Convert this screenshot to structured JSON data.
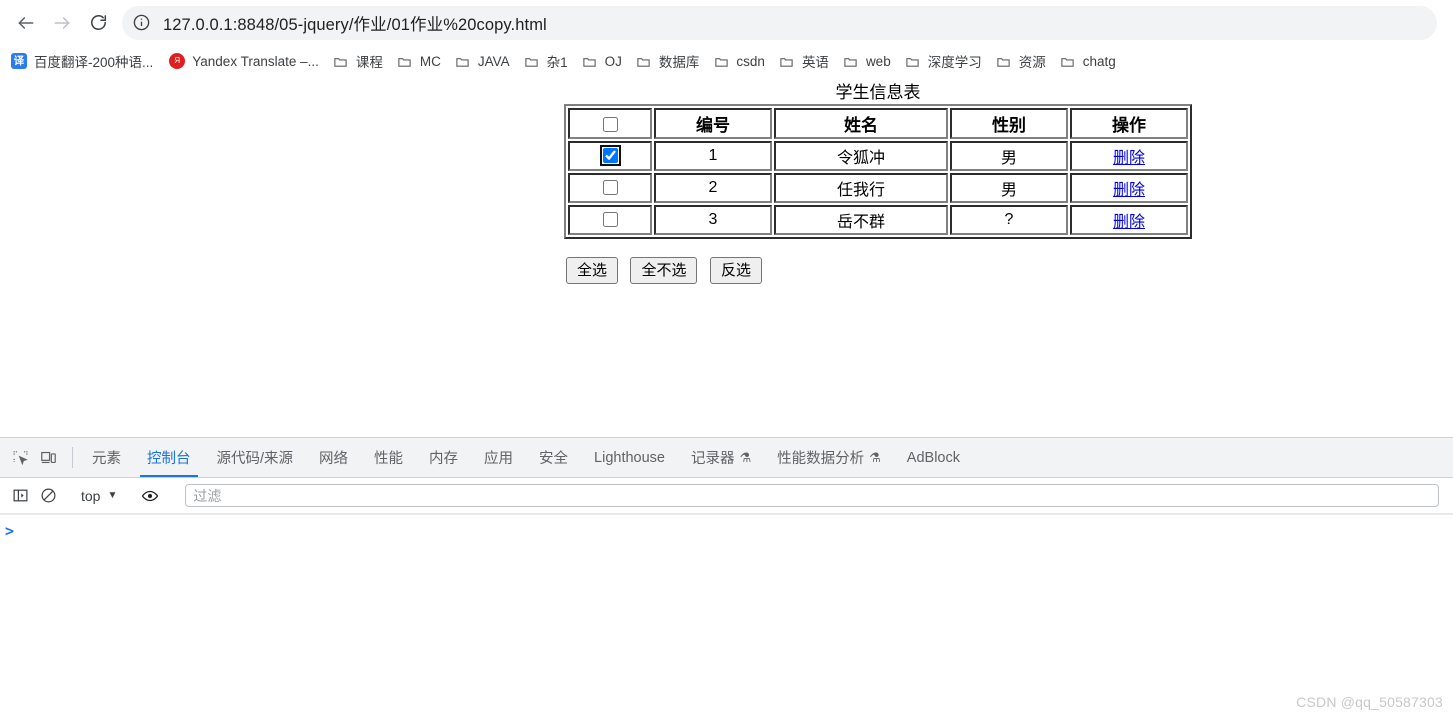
{
  "browser": {
    "nav": {
      "back_title": "Back",
      "forward_title": "Forward",
      "reload_title": "Reload"
    },
    "omnibox": {
      "url": "127.0.0.1:8848/05-jquery/作业/01作业%20copy.html",
      "site_info_icon": "info-circle-icon"
    },
    "bookmarks": [
      {
        "label": "百度翻译-200种语...",
        "icon": "baidu-translate-favicon",
        "glyph": "译"
      },
      {
        "label": "Yandex Translate –...",
        "icon": "yandex-translate-favicon",
        "glyph": "Я"
      },
      {
        "label": "课程",
        "icon": "folder-icon"
      },
      {
        "label": "MC",
        "icon": "folder-icon"
      },
      {
        "label": "JAVA",
        "icon": "folder-icon"
      },
      {
        "label": "杂1",
        "icon": "folder-icon"
      },
      {
        "label": "OJ",
        "icon": "folder-icon"
      },
      {
        "label": "数据库",
        "icon": "folder-icon"
      },
      {
        "label": "csdn",
        "icon": "folder-icon"
      },
      {
        "label": "英语",
        "icon": "folder-icon"
      },
      {
        "label": "web",
        "icon": "folder-icon"
      },
      {
        "label": "深度学习",
        "icon": "folder-icon"
      },
      {
        "label": "资源",
        "icon": "folder-icon"
      },
      {
        "label": "chatg",
        "icon": "folder-icon"
      }
    ]
  },
  "page": {
    "title": "学生信息表",
    "table": {
      "headers": [
        "",
        "编号",
        "姓名",
        "性别",
        "操作"
      ],
      "header_checkbox_checked": false,
      "rows": [
        {
          "checked": true,
          "id": "1",
          "name": "令狐冲",
          "gender": "男",
          "action": "删除"
        },
        {
          "checked": false,
          "id": "2",
          "name": "任我行",
          "gender": "男",
          "action": "删除"
        },
        {
          "checked": false,
          "id": "3",
          "name": "岳不群",
          "gender": "?",
          "action": "删除"
        }
      ]
    },
    "buttons": [
      {
        "label": "全选"
      },
      {
        "label": "全不选"
      },
      {
        "label": "反选"
      }
    ]
  },
  "devtools": {
    "left_icons": [
      {
        "name": "inspect-element-icon"
      },
      {
        "name": "device-toolbar-icon"
      }
    ],
    "tabs": [
      {
        "label": "元素",
        "active": false
      },
      {
        "label": "控制台",
        "active": true
      },
      {
        "label": "源代码/来源",
        "active": false
      },
      {
        "label": "网络",
        "active": false
      },
      {
        "label": "性能",
        "active": false
      },
      {
        "label": "内存",
        "active": false
      },
      {
        "label": "应用",
        "active": false
      },
      {
        "label": "安全",
        "active": false
      },
      {
        "label": "Lighthouse",
        "active": false
      },
      {
        "label": "记录器",
        "active": false,
        "flask": "⚗"
      },
      {
        "label": "性能数据分析",
        "active": false,
        "flask": "⚗"
      },
      {
        "label": "AdBlock",
        "active": false
      }
    ],
    "console_toolbar": {
      "sidebar_icon": "console-sidebar-icon",
      "clear_icon": "clear-console-icon",
      "context": "top",
      "context_caret": "▼",
      "eye_icon": "live-expression-eye-icon",
      "filter_placeholder": "过滤",
      "filter_value": ""
    },
    "console": {
      "prompt": ">",
      "entries": []
    }
  },
  "watermark": "CSDN @qq_50587303",
  "colors": {
    "accent": "#1a73e8",
    "link": "#0000ee",
    "checkbox_checked": "#1a73e8",
    "omnibox_bg": "#f1f3f4",
    "devtools_tabbar_bg": "#f1f3f4"
  }
}
